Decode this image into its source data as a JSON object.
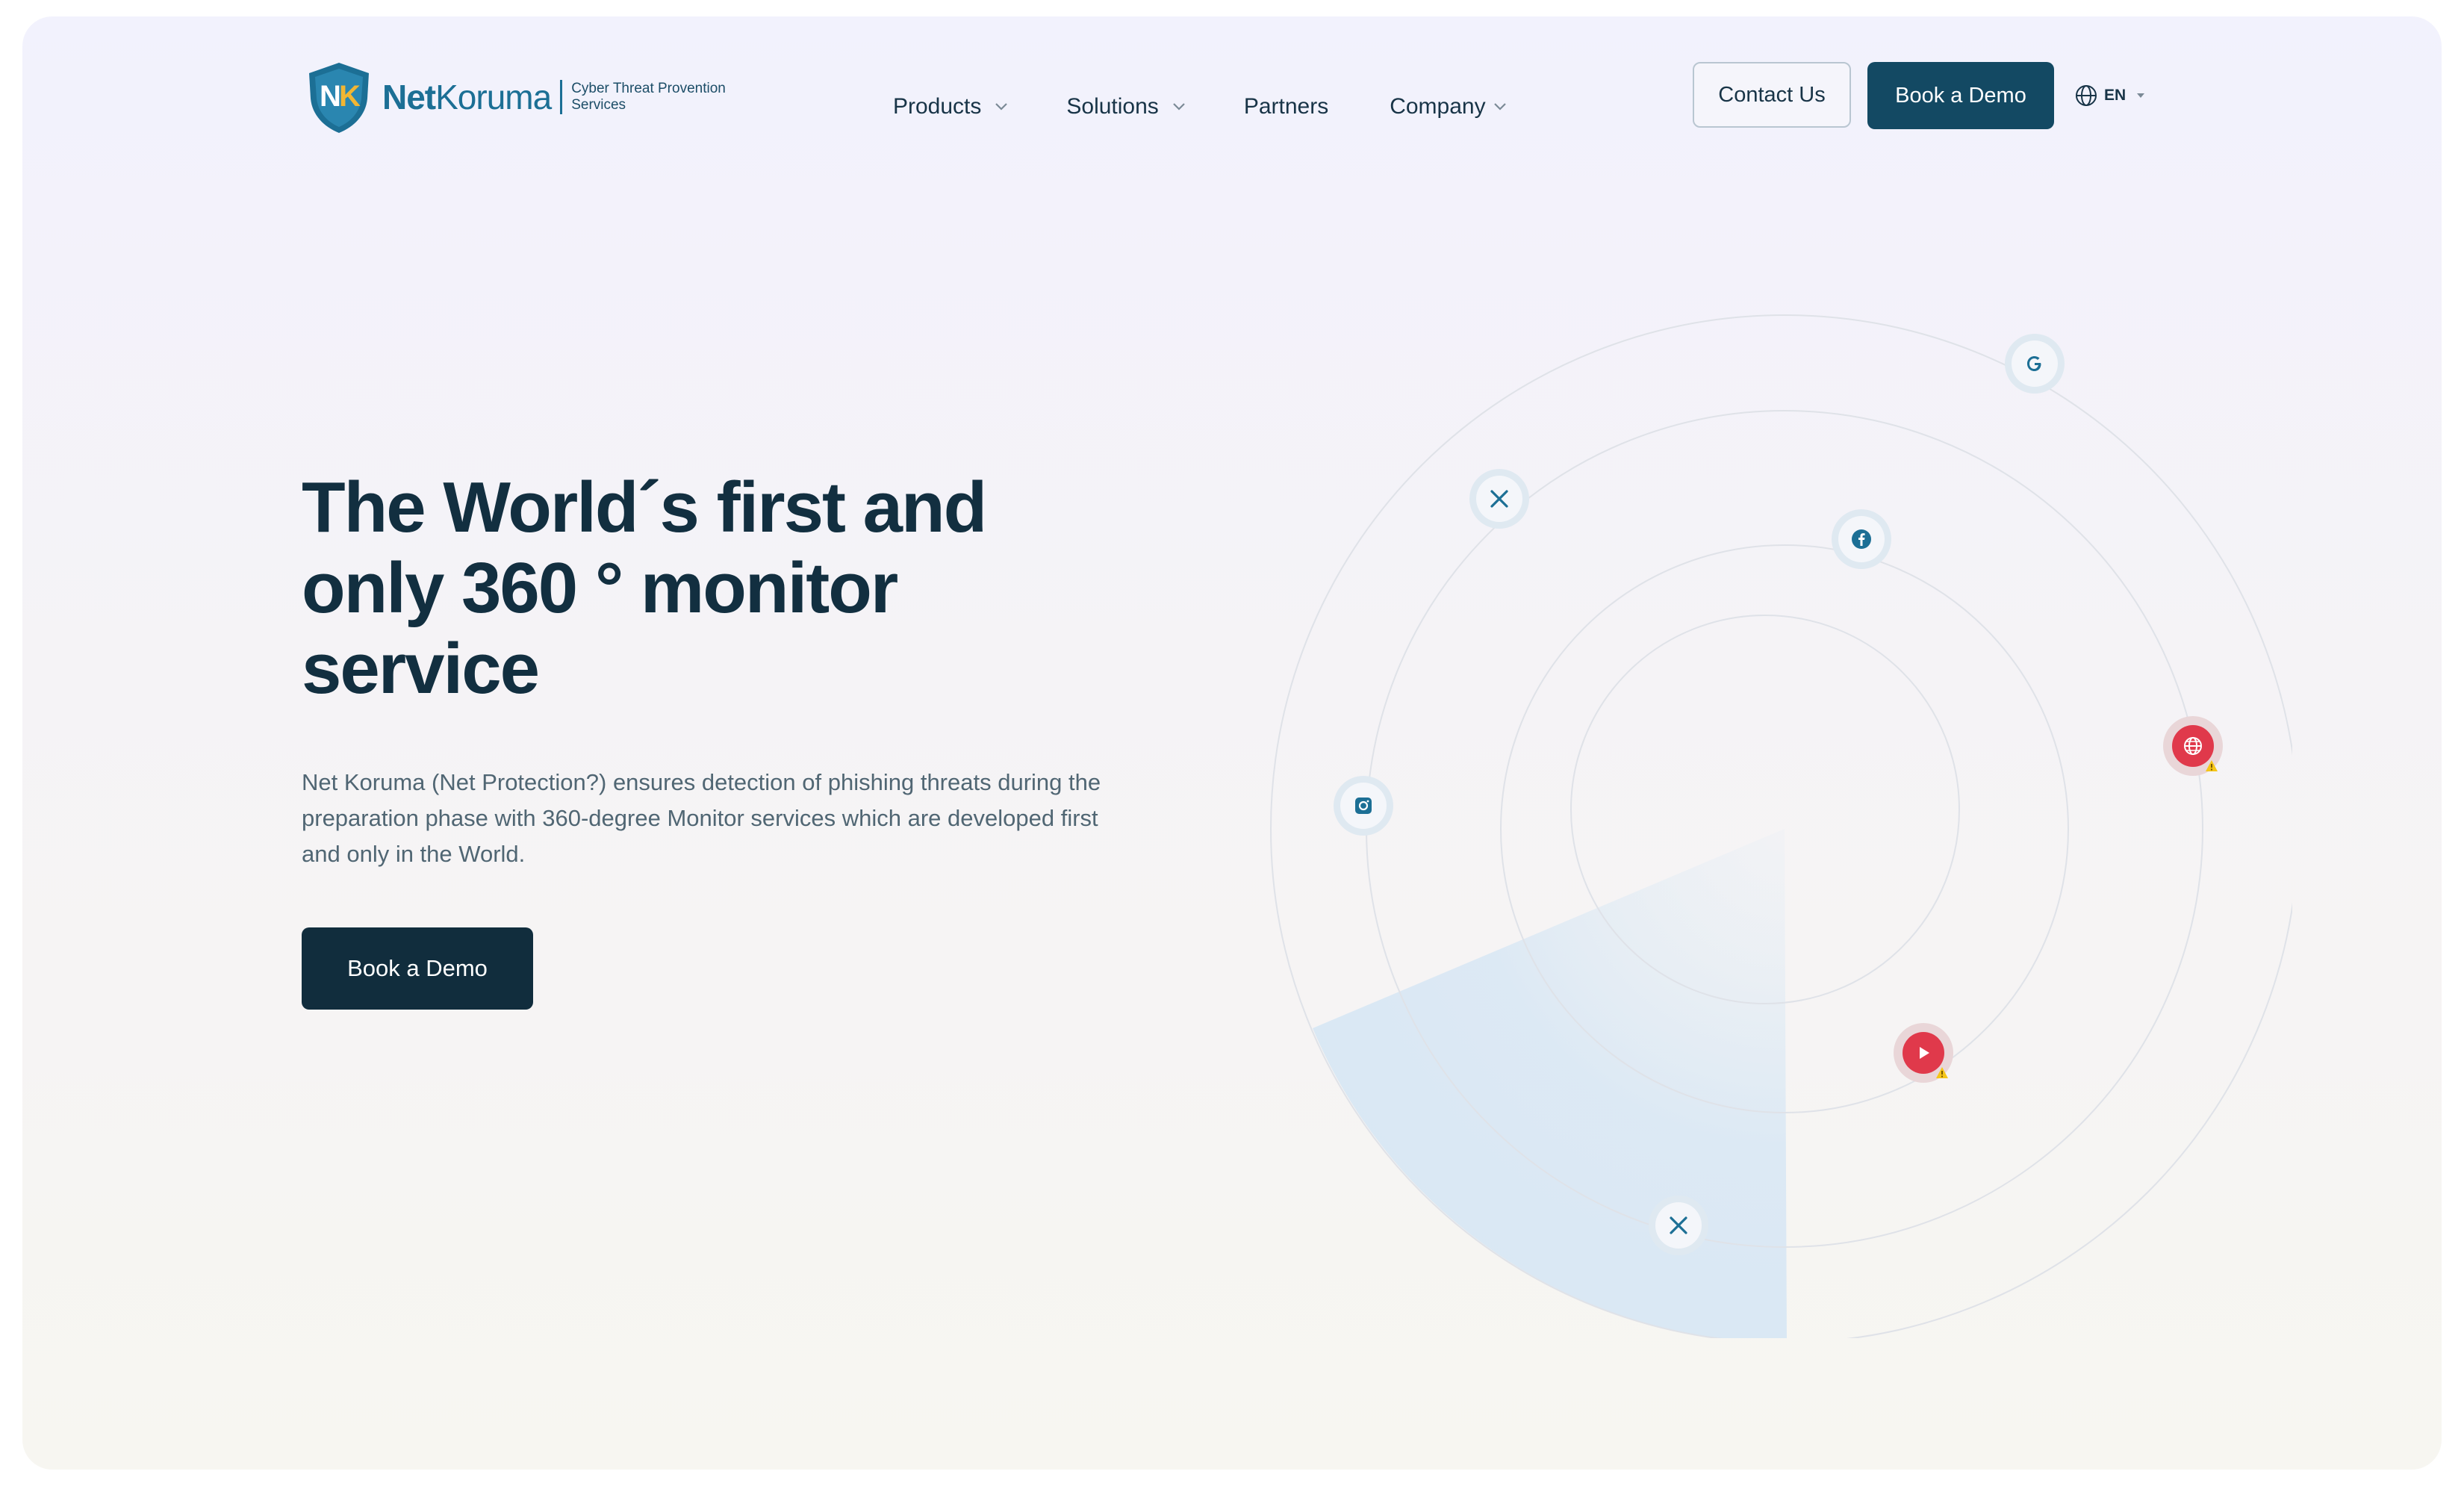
{
  "brand": {
    "name_primary": "Net",
    "name_secondary": "Koruma",
    "tagline_line1": "Cyber Threat Provention",
    "tagline_line2": "Services",
    "logo_letters": "NK"
  },
  "nav": {
    "items": [
      {
        "label": "Products",
        "has_dropdown": true
      },
      {
        "label": "Solutions",
        "has_dropdown": true
      },
      {
        "label": "Partners",
        "has_dropdown": false
      },
      {
        "label": "Company",
        "has_dropdown": true
      }
    ],
    "contact_label": "Contact Us",
    "demo_label": "Book a Demo",
    "language": "EN"
  },
  "hero": {
    "title": "The World´s first and only 360 ° monitor service",
    "description": "Net Koruma (Net Protection?) ensures detection of phishing threats during the preparation phase with 360-degree Monitor services which are developed first and only in the World.",
    "cta_label": "Book a Demo"
  },
  "radar": {
    "icons": [
      {
        "name": "google-icon",
        "status": "monitored"
      },
      {
        "name": "x-twitter-icon",
        "status": "monitored"
      },
      {
        "name": "facebook-icon",
        "status": "monitored"
      },
      {
        "name": "instagram-icon",
        "status": "monitored"
      },
      {
        "name": "globe-web-icon",
        "status": "threat"
      },
      {
        "name": "youtube-play-icon",
        "status": "threat"
      },
      {
        "name": "x-twitter-icon",
        "status": "monitored"
      }
    ]
  },
  "colors": {
    "brand_blue": "#1c6f95",
    "dark_navy": "#134963",
    "hero_button": "#112d3d",
    "title_text": "#122f40",
    "alert_red": "#e0394b",
    "warning_yellow": "#f5c518",
    "scan_sweep": "#d6e6f4"
  }
}
